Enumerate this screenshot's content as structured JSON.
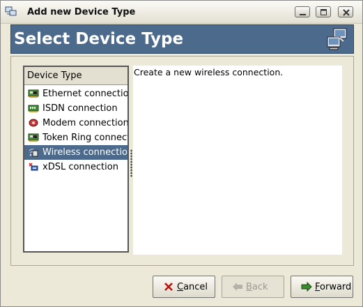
{
  "window": {
    "title": "Add new Device Type",
    "controls": [
      "minimize-icon",
      "maximize-icon",
      "close-icon"
    ]
  },
  "banner": {
    "title": "Select Device Type",
    "icon": "network-computers-icon"
  },
  "device_list": {
    "header": "Device Type",
    "items": [
      {
        "label": "Ethernet connection",
        "icon": "ethernet-card-icon",
        "selected": false
      },
      {
        "label": "ISDN connection",
        "icon": "isdn-card-icon",
        "selected": false
      },
      {
        "label": "Modem connection",
        "icon": "modem-icon",
        "selected": false
      },
      {
        "label": "Token Ring connection",
        "icon": "token-ring-card-icon",
        "selected": false
      },
      {
        "label": "Wireless connection",
        "icon": "wireless-icon",
        "selected": true
      },
      {
        "label": "xDSL connection",
        "icon": "xdsl-icon",
        "selected": false
      }
    ]
  },
  "description": "Create a new wireless connection.",
  "buttons": {
    "cancel": {
      "mnemonic": "C",
      "rest": "ancel",
      "enabled": true,
      "icon": "cancel-x-icon"
    },
    "back": {
      "mnemonic": "B",
      "rest": "ack",
      "enabled": false,
      "icon": "back-arrow-icon"
    },
    "forward": {
      "mnemonic": "F",
      "rest": "orward",
      "enabled": true,
      "icon": "forward-arrow-icon"
    }
  }
}
